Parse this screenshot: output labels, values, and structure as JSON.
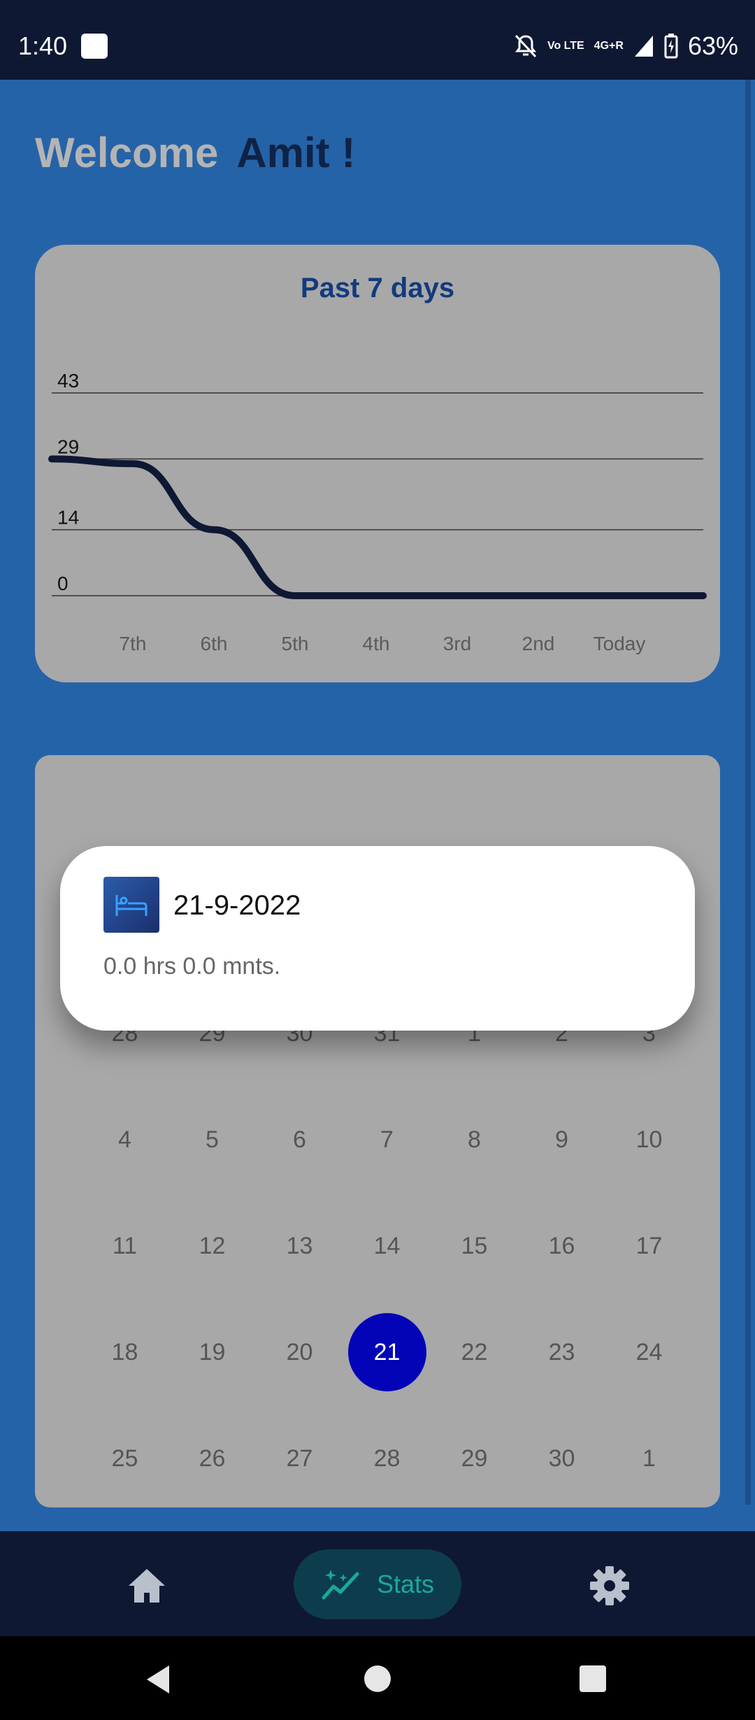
{
  "status_bar": {
    "time": "1:40",
    "network_label": "4G+R",
    "volte_label": "Vo LTE",
    "battery_text": "63%",
    "icons": [
      "notification-square-icon",
      "bell-off-icon",
      "volte-icon",
      "signal-icon",
      "battery-charging-icon"
    ]
  },
  "header": {
    "welcome_text": "Welcome",
    "user_name": "Amit !"
  },
  "chart_card": {
    "title": "Past 7 days"
  },
  "chart_data": {
    "type": "line",
    "title": "Past 7 days",
    "x": [
      "7th",
      "6th",
      "5th",
      "4th",
      "3rd",
      "2nd",
      "Today"
    ],
    "y_ticks": [
      0,
      14,
      29,
      43
    ],
    "ylim": [
      0,
      43
    ],
    "series": [
      {
        "values": [
          29,
          28,
          14,
          0,
          0,
          0,
          0,
          0
        ]
      }
    ],
    "x_points": [
      "",
      "7th",
      "6th",
      "5th",
      "4th",
      "3rd",
      "2nd",
      "Today"
    ],
    "grid": true,
    "line_color": "#0f1833"
  },
  "calendar": {
    "weeks": [
      [
        "28",
        "29",
        "30",
        "31",
        "1",
        "2",
        "3"
      ],
      [
        "4",
        "5",
        "6",
        "7",
        "8",
        "9",
        "10"
      ],
      [
        "11",
        "12",
        "13",
        "14",
        "15",
        "16",
        "17"
      ],
      [
        "18",
        "19",
        "20",
        "21",
        "22",
        "23",
        "24"
      ],
      [
        "25",
        "26",
        "27",
        "28",
        "29",
        "30",
        "1"
      ]
    ],
    "selected_day": "21",
    "selected_color": "#0303b8"
  },
  "popup": {
    "icon": "bed-icon",
    "date": "21-9-2022",
    "duration": "0.0 hrs 0.0 mnts."
  },
  "bottom_nav": {
    "items": [
      {
        "name": "home",
        "icon": "home-icon",
        "label": ""
      },
      {
        "name": "stats",
        "icon": "stats-sparkle-icon",
        "label": "Stats",
        "active": true
      },
      {
        "name": "settings",
        "icon": "gear-icon",
        "label": ""
      }
    ],
    "active_color": "#1aa89a"
  },
  "colors": {
    "background": "#2563a8",
    "card": "#a8a8a8",
    "nav": "#0f1833"
  }
}
